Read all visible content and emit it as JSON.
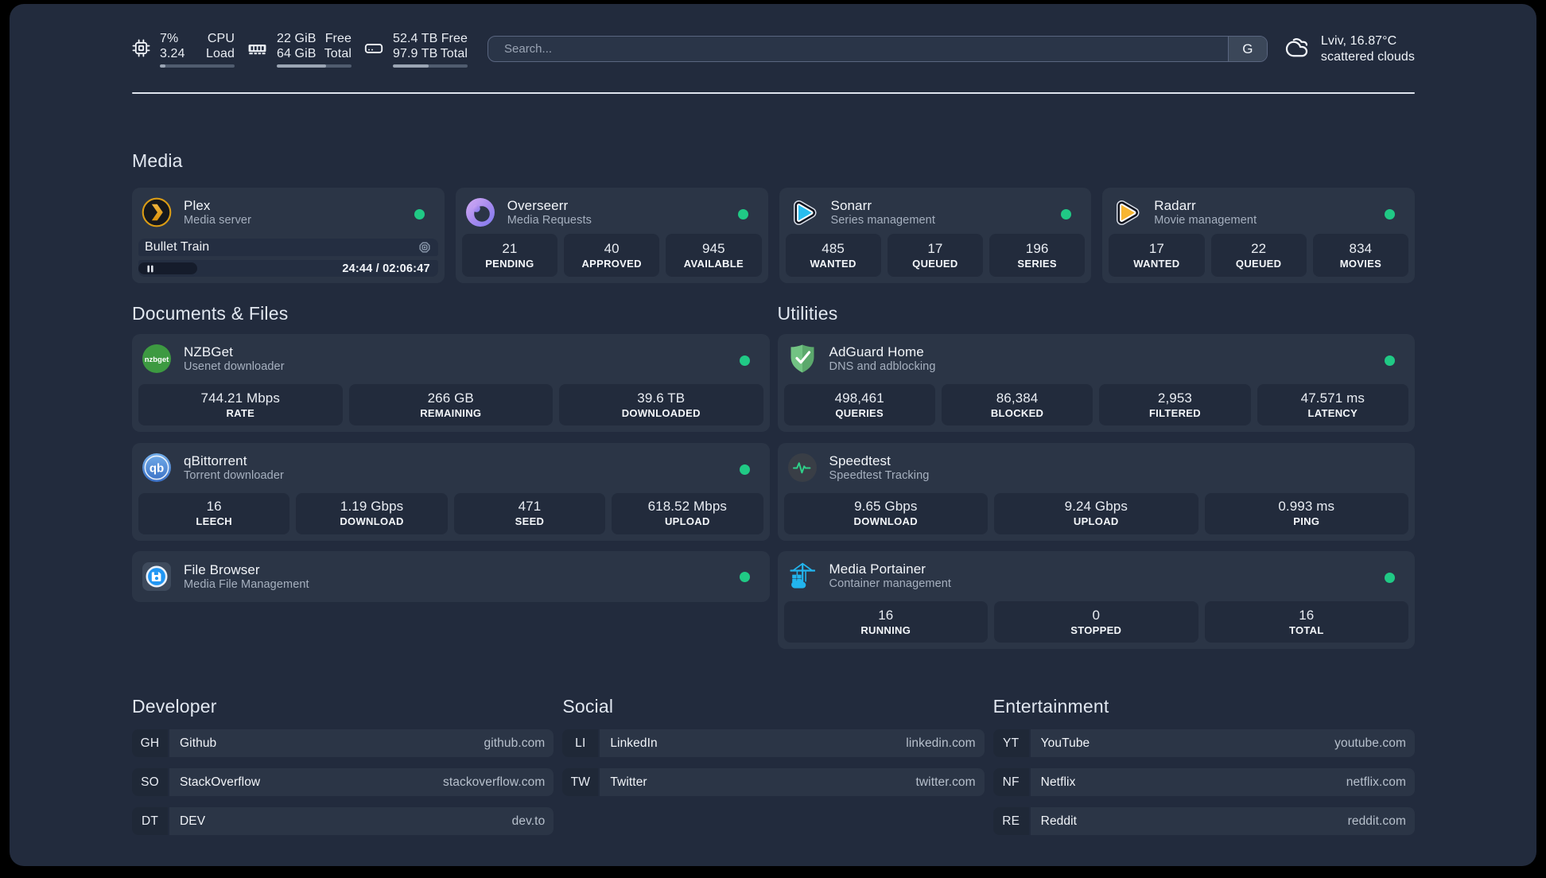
{
  "colors": {
    "page_bg": "#222b3d",
    "card_bg": "#2b3546",
    "block_bg": "#222b3c",
    "status_green": "#20c985",
    "plex_amber": "#e5a00d",
    "sonarr_cyan": "#29bdee",
    "radarr_amber": "#f7b530",
    "nzbget_green": "#3d9a41",
    "qbittorrent_blue": "#2f77d0",
    "adguard_green": "#68bc71",
    "speedtest_green": "#2fd089",
    "portainer_blue": "#22b5ee"
  },
  "topbar": {
    "cpu": {
      "value_pct": "7%",
      "label_top": "CPU",
      "value_load": "3.24",
      "label_bottom": "Load",
      "bar_pct": 7
    },
    "memory": {
      "value_free": "22 GiB",
      "label_top": "Free",
      "value_total": "64 GiB",
      "label_bottom": "Total",
      "bar_pct": 66
    },
    "disk": {
      "value_free": "52.4 TB",
      "label_top": "Free",
      "value_total": "97.9 TB",
      "label_bottom": "Total",
      "bar_pct": 48
    },
    "search": {
      "placeholder": "Search...",
      "button_label": "G"
    },
    "weather": {
      "line1": "Lviv, 16.87°C",
      "line2": "scattered clouds"
    }
  },
  "media": {
    "heading": "Media",
    "cards": [
      {
        "title": "Plex",
        "subtitle": "Media server",
        "icon": "plex-icon",
        "player": {
          "track": "Bullet Train",
          "time": "24:44 / 02:06:47",
          "progress_pct": 19.7
        }
      },
      {
        "title": "Overseerr",
        "subtitle": "Media Requests",
        "icon": "overseerr-icon",
        "stats": [
          {
            "value": "21",
            "label": "PENDING"
          },
          {
            "value": "40",
            "label": "APPROVED"
          },
          {
            "value": "945",
            "label": "AVAILABLE"
          }
        ]
      },
      {
        "title": "Sonarr",
        "subtitle": "Series management",
        "icon": "sonarr-icon",
        "stats": [
          {
            "value": "485",
            "label": "WANTED"
          },
          {
            "value": "17",
            "label": "QUEUED"
          },
          {
            "value": "196",
            "label": "SERIES"
          }
        ]
      },
      {
        "title": "Radarr",
        "subtitle": "Movie management",
        "icon": "radarr-icon",
        "stats": [
          {
            "value": "17",
            "label": "WANTED"
          },
          {
            "value": "22",
            "label": "QUEUED"
          },
          {
            "value": "834",
            "label": "MOVIES"
          }
        ]
      }
    ]
  },
  "documents": {
    "heading": "Documents & Files",
    "cards": [
      {
        "title": "NZBGet",
        "subtitle": "Usenet downloader",
        "icon": "nzbget-icon",
        "stats": [
          {
            "value": "744.21 Mbps",
            "label": "RATE"
          },
          {
            "value": "266 GB",
            "label": "REMAINING"
          },
          {
            "value": "39.6 TB",
            "label": "DOWNLOADED"
          }
        ]
      },
      {
        "title": "qBittorrent",
        "subtitle": "Torrent downloader",
        "icon": "qbittorrent-icon",
        "stats": [
          {
            "value": "16",
            "label": "LEECH"
          },
          {
            "value": "1.19 Gbps",
            "label": "DOWNLOAD"
          },
          {
            "value": "471",
            "label": "SEED"
          },
          {
            "value": "618.52 Mbps",
            "label": "UPLOAD"
          }
        ]
      },
      {
        "title": "File Browser",
        "subtitle": "Media File Management",
        "icon": "filebrowser-icon",
        "stats": []
      }
    ]
  },
  "utilities": {
    "heading": "Utilities",
    "cards": [
      {
        "title": "AdGuard Home",
        "subtitle": "DNS and adblocking",
        "icon": "adguard-icon",
        "stats": [
          {
            "value": "498,461",
            "label": "QUERIES"
          },
          {
            "value": "86,384",
            "label": "BLOCKED"
          },
          {
            "value": "2,953",
            "label": "FILTERED"
          },
          {
            "value": "47.571 ms",
            "label": "LATENCY"
          }
        ]
      },
      {
        "title": "Speedtest",
        "subtitle": "Speedtest Tracking",
        "icon": "speedtest-icon",
        "stats": [
          {
            "value": "9.65 Gbps",
            "label": "DOWNLOAD"
          },
          {
            "value": "9.24 Gbps",
            "label": "UPLOAD"
          },
          {
            "value": "0.993 ms",
            "label": "PING"
          }
        ]
      },
      {
        "title": "Media Portainer",
        "subtitle": "Container management",
        "icon": "portainer-icon",
        "stats": [
          {
            "value": "16",
            "label": "RUNNING"
          },
          {
            "value": "0",
            "label": "STOPPED"
          },
          {
            "value": "16",
            "label": "TOTAL"
          }
        ]
      }
    ]
  },
  "bookmarks": [
    {
      "heading": "Developer",
      "items": [
        {
          "abbr": "GH",
          "name": "Github",
          "url": "github.com"
        },
        {
          "abbr": "SO",
          "name": "StackOverflow",
          "url": "stackoverflow.com"
        },
        {
          "abbr": "DT",
          "name": "DEV",
          "url": "dev.to"
        }
      ]
    },
    {
      "heading": "Social",
      "items": [
        {
          "abbr": "LI",
          "name": "LinkedIn",
          "url": "linkedin.com"
        },
        {
          "abbr": "TW",
          "name": "Twitter",
          "url": "twitter.com"
        }
      ]
    },
    {
      "heading": "Entertainment",
      "items": [
        {
          "abbr": "YT",
          "name": "YouTube",
          "url": "youtube.com"
        },
        {
          "abbr": "NF",
          "name": "Netflix",
          "url": "netflix.com"
        },
        {
          "abbr": "RE",
          "name": "Reddit",
          "url": "reddit.com"
        }
      ]
    }
  ]
}
